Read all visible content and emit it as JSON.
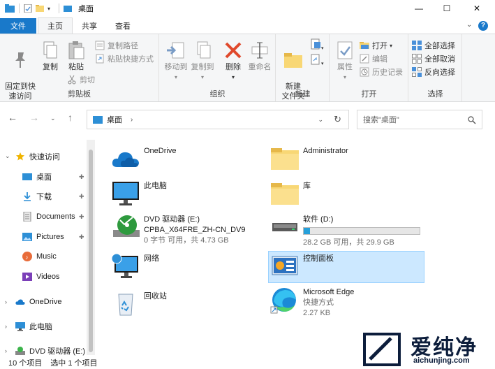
{
  "window": {
    "title": "桌面",
    "minimize": "—",
    "maximize": "☐",
    "close": "✕"
  },
  "tabs": [
    {
      "label": "文件"
    },
    {
      "label": "主页"
    },
    {
      "label": "共享"
    },
    {
      "label": "查看"
    }
  ],
  "ribbon": {
    "clipboard": {
      "label": "剪贴板",
      "pin_quick": "固定到快\n速访问",
      "copy": "复制",
      "paste": "粘贴",
      "copy_path": "复制路径",
      "paste_shortcut": "粘贴快捷方式",
      "cut": "剪切"
    },
    "organize": {
      "label": "组织",
      "move_to": "移动到",
      "copy_to": "复制到",
      "delete": "删除",
      "rename": "重命名"
    },
    "new": {
      "label": "新建",
      "new_folder": "新建\n文件夹"
    },
    "open": {
      "label": "打开",
      "properties": "属性",
      "open": "打开",
      "edit": "编辑",
      "history": "历史记录"
    },
    "select": {
      "label": "选择",
      "select_all": "全部选择",
      "select_none": "全部取消",
      "invert": "反向选择"
    }
  },
  "address": {
    "path": "桌面",
    "search_placeholder": "搜索\"桌面\""
  },
  "nav": {
    "quick_access": "快速访问",
    "desktop": "桌面",
    "downloads": "下载",
    "documents": "Documents",
    "pictures": "Pictures",
    "music": "Music",
    "videos": "Videos",
    "onedrive": "OneDrive",
    "this_pc": "此电脑",
    "dvd": "DVD 驱动器 (E:)"
  },
  "items": {
    "onedrive": {
      "name": "OneDrive"
    },
    "administrator": {
      "name": "Administrator"
    },
    "this_pc": {
      "name": "此电脑"
    },
    "library": {
      "name": "库"
    },
    "dvd": {
      "name": "DVD 驱动器 (E:)",
      "label": "CPBA_X64FRE_ZH-CN_DV9",
      "space": "0 字节 可用，共 4.73 GB"
    },
    "software": {
      "name": "软件 (D:)",
      "space": "28.2 GB 可用，共 29.9 GB",
      "used_fraction": 0.057
    },
    "network": {
      "name": "网络"
    },
    "control_panel": {
      "name": "控制面板"
    },
    "recycle_bin": {
      "name": "回收站"
    },
    "edge": {
      "name": "Microsoft Edge",
      "type": "快捷方式",
      "size": "2.27 KB"
    }
  },
  "status": {
    "count": "10 个项目",
    "selected": "选中 1 个项目"
  },
  "watermark": {
    "title": "爱纯净",
    "url": "aichunjing.com"
  },
  "colors": {
    "accent": "#1979ca",
    "selection": "#cce8ff",
    "folder": "#f8d775"
  }
}
